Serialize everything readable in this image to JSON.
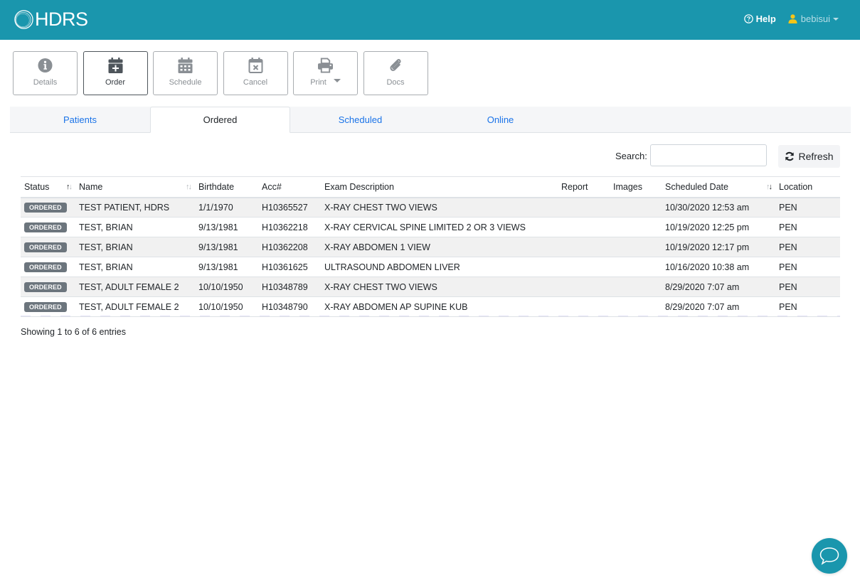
{
  "navbar": {
    "brand": "HDRS",
    "help_label": "Help",
    "user_label": "bebisui",
    "colors": {
      "background": "#1a96ad",
      "user_icon": "#f5c518"
    }
  },
  "toolbar": {
    "buttons": [
      {
        "label": "Details",
        "icon": "info-circle-icon",
        "active": false
      },
      {
        "label": "Order",
        "icon": "calendar-plus-icon",
        "active": true
      },
      {
        "label": "Schedule",
        "icon": "calendar-grid-icon",
        "active": false
      },
      {
        "label": "Cancel",
        "icon": "calendar-x-icon",
        "active": false
      },
      {
        "label": "Print",
        "icon": "printer-icon",
        "active": false,
        "dropdown": true
      },
      {
        "label": "Docs",
        "icon": "paperclip-icon",
        "active": false
      }
    ]
  },
  "tabs": [
    {
      "label": "Patients",
      "active": false
    },
    {
      "label": "Ordered",
      "active": true
    },
    {
      "label": "Scheduled",
      "active": false
    },
    {
      "label": "Online",
      "active": false
    }
  ],
  "search": {
    "label": "Search:",
    "value": "",
    "placeholder": ""
  },
  "refresh_label": "Refresh",
  "table": {
    "columns": [
      "Status",
      "Name",
      "Birthdate",
      "Acc#",
      "Exam Description",
      "Report",
      "Images",
      "Scheduled Date",
      "Location"
    ],
    "rows": [
      {
        "status": "ORDERED",
        "name": "TEST PATIENT, HDRS",
        "birthdate": "1/1/1970",
        "acc": "H10365527",
        "exam": "X-RAY CHEST TWO VIEWS",
        "report": "",
        "images": "",
        "scheduled": "10/30/2020 12:53 am",
        "location": "PEN"
      },
      {
        "status": "ORDERED",
        "name": "TEST, BRIAN",
        "birthdate": "9/13/1981",
        "acc": "H10362218",
        "exam": "X-RAY CERVICAL SPINE LIMITED 2 OR 3 VIEWS",
        "report": "",
        "images": "",
        "scheduled": "10/19/2020 12:25 pm",
        "location": "PEN"
      },
      {
        "status": "ORDERED",
        "name": "TEST, BRIAN",
        "birthdate": "9/13/1981",
        "acc": "H10362208",
        "exam": "X-RAY ABDOMEN 1 VIEW",
        "report": "",
        "images": "",
        "scheduled": "10/19/2020 12:17 pm",
        "location": "PEN"
      },
      {
        "status": "ORDERED",
        "name": "TEST, BRIAN",
        "birthdate": "9/13/1981",
        "acc": "H10361625",
        "exam": "ULTRASOUND ABDOMEN LIVER",
        "report": "",
        "images": "",
        "scheduled": "10/16/2020 10:38 am",
        "location": "PEN"
      },
      {
        "status": "ORDERED",
        "name": "TEST, ADULT FEMALE 2",
        "birthdate": "10/10/1950",
        "acc": "H10348789",
        "exam": "X-RAY CHEST TWO VIEWS",
        "report": "",
        "images": "",
        "scheduled": "8/29/2020 7:07 am",
        "location": "PEN"
      },
      {
        "status": "ORDERED",
        "name": "TEST, ADULT FEMALE 2",
        "birthdate": "10/10/1950",
        "acc": "H10348790",
        "exam": "X-RAY ABDOMEN AP SUPINE KUB",
        "report": "",
        "images": "",
        "scheduled": "8/29/2020 7:07 am",
        "location": "PEN"
      }
    ]
  },
  "info_text": "Showing 1 to 6 of 6 entries"
}
